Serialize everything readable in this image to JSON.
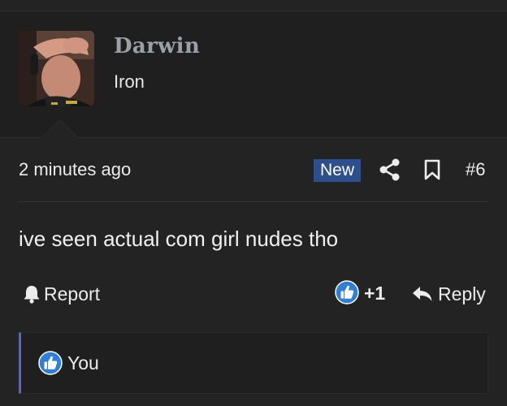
{
  "author": {
    "username": "Darwin",
    "user_title": "Iron",
    "avatar_icon": "user-avatar-photo"
  },
  "post_meta": {
    "time": "2 minutes ago",
    "new_badge": "New",
    "share_icon": "share-icon",
    "bookmark_icon": "bookmark-icon",
    "post_number": "#6"
  },
  "post": {
    "body": "ive seen actual com girl nudes tho"
  },
  "actions": {
    "report_label": "Report",
    "report_icon": "bell-icon",
    "like_icon": "thumbs-up-icon",
    "like_count": "+1",
    "reply_label": "Reply",
    "reply_icon": "reply-arrow-icon"
  },
  "reactions": {
    "icon": "thumbs-up-icon",
    "users": "You"
  },
  "colors": {
    "background": "#232323",
    "author_block": "#1f1f1f",
    "badge_bg": "#2d4f8e",
    "like_blue": "#2f7fd9",
    "reactions_accent": "#5b6ab0",
    "username": "#9aa0a6"
  }
}
